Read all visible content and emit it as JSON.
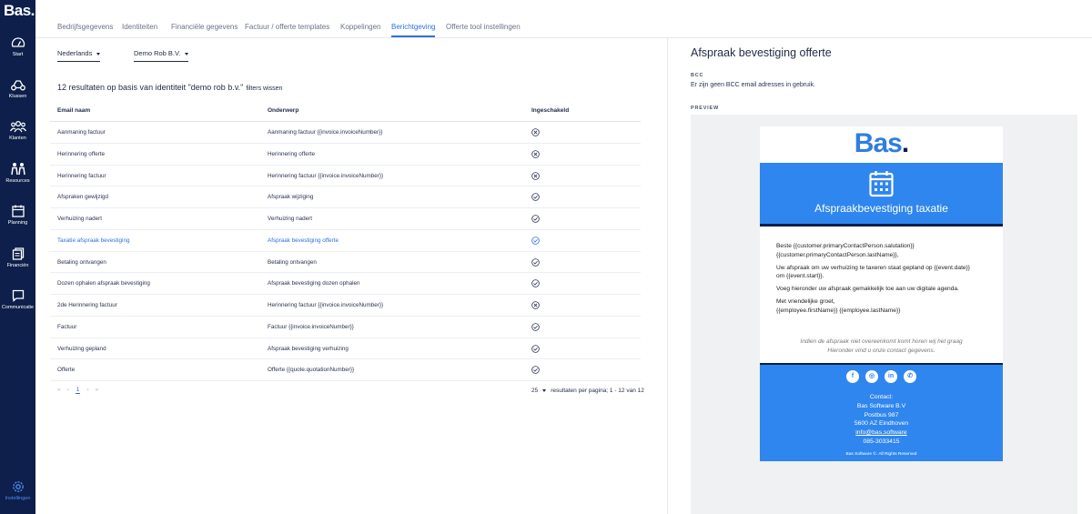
{
  "app": {
    "logo": "Bas."
  },
  "sidebar": {
    "items": [
      {
        "label": "Start",
        "icon": "dashboard-icon"
      },
      {
        "label": "Klussen",
        "icon": "truck-icon"
      },
      {
        "label": "Klanten",
        "icon": "users-icon"
      },
      {
        "label": "Resources",
        "icon": "people-icon"
      },
      {
        "label": "Planning",
        "icon": "calendar-icon"
      },
      {
        "label": "Financiën",
        "icon": "invoice-icon"
      },
      {
        "label": "Communicatie",
        "icon": "chat-icon"
      }
    ],
    "settings": {
      "label": "Instellingen",
      "icon": "gear-icon"
    }
  },
  "tabs": [
    {
      "label": "Bedrijfsgegevens"
    },
    {
      "label": "Identiteiten"
    },
    {
      "label": "Financiële gegevens"
    },
    {
      "label": "Factuur / offerte templates"
    },
    {
      "label": "Koppelingen"
    },
    {
      "label": "Berichtgeving",
      "active": true
    },
    {
      "label": "Offerte tool instellingen"
    }
  ],
  "filters": {
    "language": "Nederlands",
    "identity": "Demo Rob B.V."
  },
  "results": {
    "text": "12 resultaten op basis van identiteit \"demo rob b.v.\"",
    "clear_label": "filters wissen"
  },
  "table": {
    "headers": [
      "Email naam",
      "Onderwerp",
      "Ingeschakeld"
    ],
    "rows": [
      {
        "name": "Aanmaning factuur",
        "subject": "Aanmaning factuur {{invoice.invoiceNumber}}",
        "enabled": false
      },
      {
        "name": "Herinnering offerte",
        "subject": "Herinnering offerte",
        "enabled": false
      },
      {
        "name": "Herinnering factuur",
        "subject": "Herinnering factuur {{invoice.invoiceNumber}}",
        "enabled": false
      },
      {
        "name": "Afspraken gewijzigd",
        "subject": "Afspraak wijziging",
        "enabled": true
      },
      {
        "name": "Verhuizing nadert",
        "subject": "Verhuizing nadert",
        "enabled": true
      },
      {
        "name": "Taxatie afspraak bevestiging",
        "subject": "Afspraak bevestiging offerte",
        "enabled": true,
        "selected": true
      },
      {
        "name": "Betaling ontvangen",
        "subject": "Betaling ontvangen",
        "enabled": true
      },
      {
        "name": "Dozen ophalen afspraak bevestiging",
        "subject": "Afspraak bevestiging dozen ophalen",
        "enabled": true
      },
      {
        "name": "2de Herinnering factuur",
        "subject": "Herinnering factuur {{invoice.invoiceNumber}}",
        "enabled": false
      },
      {
        "name": "Factuur",
        "subject": "Factuur {{invoice.invoiceNumber}}",
        "enabled": true
      },
      {
        "name": "Verhuizing gepland",
        "subject": "Afspraak bevestiging verhuizing",
        "enabled": true
      },
      {
        "name": "Offerte",
        "subject": "Offerte {{quote.quotationNumber}}",
        "enabled": true
      }
    ]
  },
  "pagination": {
    "current_page": "1",
    "per_page": "25",
    "per_page_label": "resultaten per pagina; 1 - 12 van 12"
  },
  "detail": {
    "title": "Afspraak bevestiging offerte",
    "bcc_label": "BCC",
    "bcc_text": "Er zijn geen BCC email adresses in gebruik.",
    "preview_label": "PREVIEW"
  },
  "email": {
    "logo_text": "Bas",
    "logo_dot": ".",
    "banner_title": "Afspraakbevestiging taxatie",
    "greeting_line1": "Beste  {{customer.primaryContactPerson.salutation}}",
    "greeting_line2": "{{customer.primaryContactPerson.lastName}},",
    "para1_line1": "Uw afspraak om uw verhuizing te taxeren staat gepland op {{event.date}}",
    "para1_line2": "om {{event.start}}.",
    "para2": "Voeg hieronder uw afspraak gemakkelijk toe aan uw digitale agenda.",
    "closing": "Met vriendelijke groet,",
    "signature": "{{employee.firstName}} {{employee.lastName}}",
    "note_line1": "Indien de afspraak niet overeenkomt komt horen wij het graag",
    "note_line2": "Hieronder vind u onze contact gegevens.",
    "contact_label": "Contact:",
    "company": "Bas Software B.V",
    "address": "Postbus 987",
    "city": "5600 AZ Eindhoven",
    "email_link": "info@bas.software",
    "phone": "085-3033415",
    "rights": "Bas Software ©. All Rights Reserved"
  },
  "colors": {
    "sidebar": "#0d1f4a",
    "accent": "#2f6fe0",
    "email_blue": "#2f86ee"
  }
}
